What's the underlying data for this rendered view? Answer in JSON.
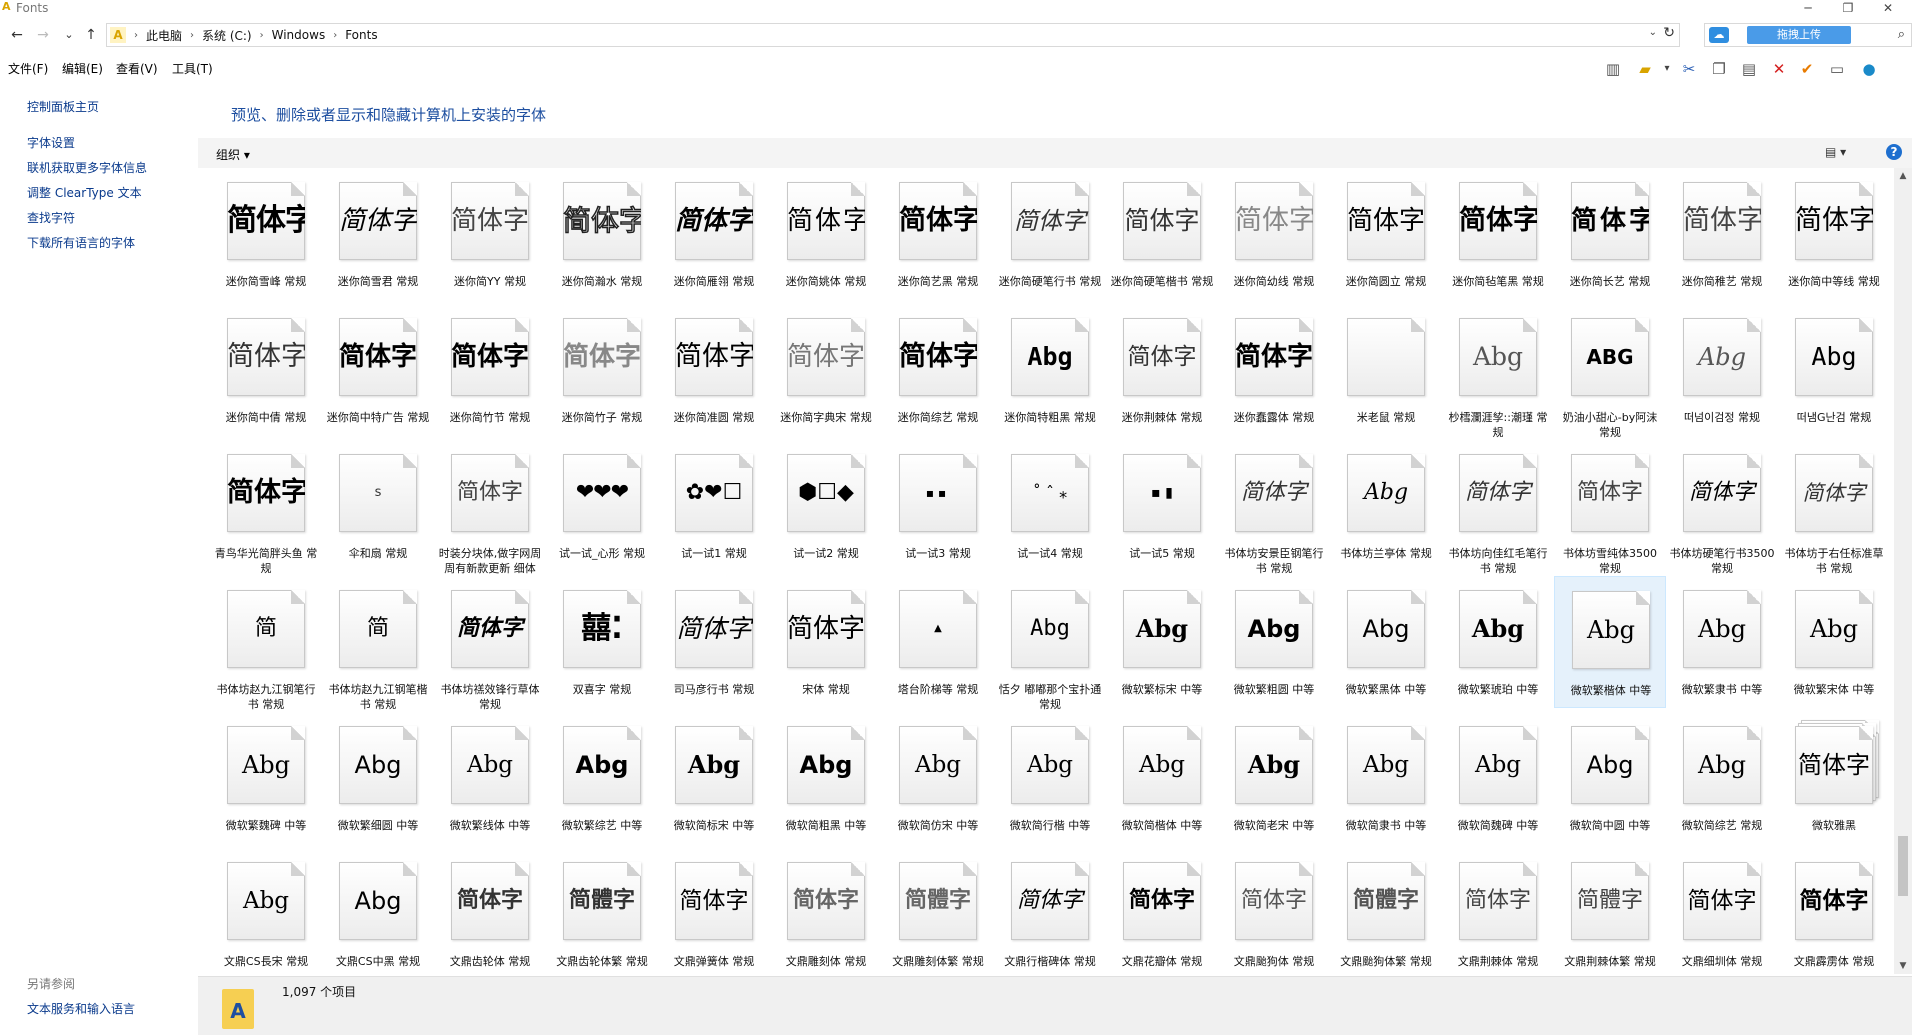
{
  "window": {
    "title": "Fonts",
    "app_icon": "fonts-folder-icon"
  },
  "window_controls": {
    "minimize": "─",
    "maximize": "❐",
    "close": "✕"
  },
  "nav": {
    "back": "←",
    "forward": "→",
    "recent": "⌄",
    "up": "↑"
  },
  "address": {
    "crumbs": [
      "此电脑",
      "系统 (C:)",
      "Windows",
      "Fonts"
    ],
    "dropdown": "⌄",
    "refresh": "↻"
  },
  "search": {
    "upload_label": "拖拽上传",
    "baidu_icon": "☁",
    "search_icon": "⌕"
  },
  "menu": [
    "文件(F)",
    "编辑(E)",
    "查看(V)",
    "工具(T)"
  ],
  "toolbar_icons": [
    "panel-icon",
    "folder-icon",
    "cut-icon",
    "copy-icon",
    "paste-icon",
    "delete-icon",
    "check-icon",
    "rename-icon",
    "network-icon"
  ],
  "sidebar": {
    "links": [
      "控制面板主页",
      "字体设置",
      "联机获取更多字体信息",
      "调整 ClearType 文本",
      "查找字符",
      "下载所有语言的字体"
    ],
    "see_also": "另请参阅",
    "see_also_links": [
      "文本服务和输入语言"
    ]
  },
  "page_title": "预览、删除或者显示和隐藏计算机上安装的字体",
  "cmdbar": {
    "organize": "组织 ▾",
    "view_icon": "▤ ▾",
    "help_icon": "?"
  },
  "fonts": [
    {
      "preview": "简体字",
      "name": "迷你简雪峰 常规",
      "style": "font-weight:bold;font-size:30px;letter-spacing:-1px;"
    },
    {
      "preview": "简体字",
      "name": "迷你简雪君 常规",
      "style": "font-size:26px;font-style:italic;"
    },
    {
      "preview": "简体字",
      "name": "迷你简YY 常规",
      "style": "font-size:26px;color:#444;"
    },
    {
      "preview": "简体字",
      "name": "迷你简瀚水 常规",
      "style": "font-size:28px;color:#fff;-webkit-text-stroke:1.5px #222;"
    },
    {
      "preview": "简体字",
      "name": "迷你简雁翎 常规",
      "style": "font-weight:bold;font-size:26px;font-style:italic;"
    },
    {
      "preview": "简体字",
      "name": "迷你简姚体 常规",
      "style": "font-size:26px;letter-spacing:2px;"
    },
    {
      "preview": "简体字",
      "name": "迷你简艺黑 常规",
      "style": "font-weight:bold;font-size:27px;"
    },
    {
      "preview": "简体字",
      "name": "迷你简硬笔行书 常规",
      "style": "font-size:24px;font-style:italic;color:#333;"
    },
    {
      "preview": "简体字",
      "name": "迷你简硬笔楷书 常规",
      "style": "font-size:25px;color:#333;"
    },
    {
      "preview": "简体字",
      "name": "迷你简幼线 常规",
      "style": "font-size:27px;color:#888;"
    },
    {
      "preview": "简体字",
      "name": "迷你简圆立 常规",
      "style": "font-size:26px;"
    },
    {
      "preview": "简体字",
      "name": "迷你简毡笔黑 常规",
      "style": "font-weight:bold;font-size:27px;"
    },
    {
      "preview": "简体字",
      "name": "迷你简长艺 常规",
      "style": "font-weight:bold;font-size:26px;letter-spacing:3px;"
    },
    {
      "preview": "简体字",
      "name": "迷你简稚艺 常规",
      "style": "font-size:27px;color:#444;"
    },
    {
      "preview": "简体字",
      "name": "迷你简中等线 常规",
      "style": "font-size:27px;"
    },
    {
      "preview": "简体字",
      "name": "迷你简中倩 常规",
      "style": "font-size:27px;color:#333;"
    },
    {
      "preview": "简体字",
      "name": "迷你简中特广告 常规",
      "style": "font-weight:bold;font-size:26px;"
    },
    {
      "preview": "简体字",
      "name": "迷你简竹节 常规",
      "style": "font-weight:bold;font-size:26px;"
    },
    {
      "preview": "简体字",
      "name": "迷你简竹子 常规",
      "style": "font-size:26px;color:#888;font-weight:bold;"
    },
    {
      "preview": "简体字",
      "name": "迷你简准圆 常规",
      "style": "font-size:27px;"
    },
    {
      "preview": "简体字",
      "name": "迷你简字典宋 常规",
      "style": "font-size:26px;color:#777;"
    },
    {
      "preview": "简体字",
      "name": "迷你简综艺 常规",
      "style": "font-weight:bold;font-size:27px;"
    },
    {
      "preview": "Abg",
      "name": "迷你简特粗黑 常规",
      "style": "font-family:'DejaVu Sans Mono',monospace;font-weight:bold;font-size:25px;"
    },
    {
      "preview": "简体字",
      "name": "迷你荆棘体 常规",
      "style": "font-size:23px;color:#333;"
    },
    {
      "preview": "简体字",
      "name": "迷你蠢露体 常规",
      "style": "font-weight:bold;font-size:26px;"
    },
    {
      "preview": "",
      "name": "米老鼠 常规",
      "style": ""
    },
    {
      "preview": "Abg",
      "name": "杪樰瀾涯孧::潮瑾 常规",
      "style": "font-family:'DejaVu Serif',serif;font-size:25px;color:#555;"
    },
    {
      "preview": "ABG",
      "name": "奶油小甜心-by阿沫 常规",
      "style": "font-weight:bold;font-size:20px;"
    },
    {
      "preview": "Abg",
      "name": "떠넘이검정 常规",
      "style": "font-family:'DejaVu Serif',serif;font-style:italic;font-size:24px;color:#555;"
    },
    {
      "preview": "Abg",
      "name": "떠냄G난검 常规",
      "style": "font-family:'DejaVu Sans Mono',monospace;font-size:25px;"
    },
    {
      "preview": "简体字",
      "name": "青鸟华光简胖头鱼 常规",
      "style": "font-weight:bold;font-size:27px;"
    },
    {
      "preview": "s",
      "name": "伞和扇 常规",
      "style": "font-size:13px;color:#333;"
    },
    {
      "preview": "简体字",
      "name": "时装分块体,做字网周周有新款更新 细体",
      "style": "font-size:22px;color:#444;"
    },
    {
      "preview": "❤❤❤",
      "name": "试一试_心形 常规",
      "style": "font-size:22px;letter-spacing:-1px;"
    },
    {
      "preview": "✿❤☐",
      "name": "试一试1 常规",
      "style": "font-size:22px;"
    },
    {
      "preview": "⬢☐◆",
      "name": "试一试2 常规",
      "style": "font-size:22px;"
    },
    {
      "preview": "▪▪",
      "name": "试一试3 常规",
      "style": "font-size:12px;letter-spacing:4px;"
    },
    {
      "preview": "˚  ˆ  ⁎",
      "name": "试一试4 常规",
      "style": "font-size:16px;"
    },
    {
      "preview": "▪   ▮",
      "name": "试一试5 常规",
      "style": "font-size:14px;"
    },
    {
      "preview": "简体字",
      "name": "书体坊安景臣钢笔行书 常规",
      "style": "font-size:22px;font-style:italic;color:#333;"
    },
    {
      "preview": "Abg",
      "name": "书体坊兰亭体 常规",
      "style": "font-family:'DejaVu Serif',serif;font-style:italic;font-size:22px;"
    },
    {
      "preview": "简体字",
      "name": "书体坊向佳红毛笔行书 常规",
      "style": "font-size:22px;font-style:italic;color:#333;"
    },
    {
      "preview": "简体字",
      "name": "书体坊雪纯体3500 常规",
      "style": "font-size:22px;color:#444;"
    },
    {
      "preview": "简体字",
      "name": "书体坊硬笔行书3500 常规",
      "style": "font-size:22px;font-style:italic;"
    },
    {
      "preview": "简体字",
      "name": "书体坊于右任标准草书 常规",
      "style": "font-size:21px;font-style:italic;color:#333;"
    },
    {
      "preview": "简",
      "name": "书体坊赵九江钢笔行书 常规",
      "style": "font-size:22px;"
    },
    {
      "preview": "简",
      "name": "书体坊赵九江钢笔楷书 常规",
      "style": "font-size:22px;"
    },
    {
      "preview": "简体字",
      "name": "书体坊禚效锋行草体 常规",
      "style": "font-size:22px;font-weight:bold;font-style:italic;"
    },
    {
      "preview": "囍⁚",
      "name": "双喜字 常规",
      "style": "font-size:30px;font-weight:bold;"
    },
    {
      "preview": "简体字",
      "name": "司马彦行书 常规",
      "style": "font-size:25px;font-style:italic;"
    },
    {
      "preview": "简体字",
      "name": "宋体 常规",
      "style": "font-family:'DejaVu Serif',serif;font-size:26px;"
    },
    {
      "preview": "▲",
      "name": "塔台阶梯等 常规",
      "style": "font-size:10px;"
    },
    {
      "preview": "Abg",
      "name": "恬夕 嘟嘟那个宝扑通 常规",
      "style": "font-family:'DejaVu Sans Mono',monospace;font-size:22px;"
    },
    {
      "preview": "Abg",
      "name": "微软繁标宋 中等",
      "style": "font-family:'DejaVu Serif',serif;font-weight:bold;font-size:24px;"
    },
    {
      "preview": "Abg",
      "name": "微软繁粗圆 中等",
      "style": "font-weight:bold;font-size:24px;"
    },
    {
      "preview": "Abg",
      "name": "微软繁黑体 中等",
      "style": "font-size:24px;"
    },
    {
      "preview": "Abg",
      "name": "微软繁琥珀 中等",
      "style": "font-family:'DejaVu Serif',serif;font-weight:bold;font-size:24px;"
    },
    {
      "preview": "Abg",
      "name": "微软繁楷体 中等",
      "style": "font-family:'DejaVu Serif',serif;font-size:24px;"
    },
    {
      "preview": "Abg",
      "name": "微软繁隶书 中等",
      "style": "font-family:'DejaVu Serif',serif;font-size:24px;"
    },
    {
      "preview": "Abg",
      "name": "微软繁宋体 中等",
      "style": "font-family:'DejaVu Serif',serif;font-size:24px;"
    },
    {
      "preview": "Abg",
      "name": "微软繁魏碑 中等",
      "style": "font-family:'DejaVu Serif',serif;font-size:24px;"
    },
    {
      "preview": "Abg",
      "name": "微软繁细圆 中等",
      "style": "font-size:24px;"
    },
    {
      "preview": "Abg",
      "name": "微软繁线体 中等",
      "style": "font-family:'DejaVu Serif',serif;font-size:23px;"
    },
    {
      "preview": "Abg",
      "name": "微软繁综艺 中等",
      "style": "font-weight:bold;font-size:24px;"
    },
    {
      "preview": "Abg",
      "name": "微软简标宋 中等",
      "style": "font-family:'DejaVu Serif',serif;font-weight:bold;font-size:24px;"
    },
    {
      "preview": "Abg",
      "name": "微软简粗黑 中等",
      "style": "font-weight:bold;font-size:24px;"
    },
    {
      "preview": "Abg",
      "name": "微软简仿宋 中等",
      "style": "font-family:'DejaVu Serif',serif;font-size:23px;"
    },
    {
      "preview": "Abg",
      "name": "微软简行楷 中等",
      "style": "font-family:'DejaVu Serif',serif;font-size:23px;"
    },
    {
      "preview": "Abg",
      "name": "微软简楷体 中等",
      "style": "font-family:'DejaVu Serif',serif;font-size:23px;"
    },
    {
      "preview": "Abg",
      "name": "微软简老宋 中等",
      "style": "font-family:'DejaVu Serif',serif;font-weight:bold;font-size:24px;"
    },
    {
      "preview": "Abg",
      "name": "微软简隶书 中等",
      "style": "font-family:'DejaVu Serif',serif;font-size:23px;"
    },
    {
      "preview": "Abg",
      "name": "微软简魏碑 中等",
      "style": "font-family:'DejaVu Serif',serif;font-size:23px;"
    },
    {
      "preview": "Abg",
      "name": "微软简中圆 中等",
      "style": "font-size:24px;"
    },
    {
      "preview": "Abg",
      "name": "微软简综艺 常规",
      "style": "font-family:'DejaVu Serif',serif;font-size:24px;"
    },
    {
      "preview": "简体字",
      "name": "微软雅黑",
      "style": "font-size:24px;",
      "stack": true
    },
    {
      "preview": "Abg",
      "name": "文鼎CS長宋 常规",
      "style": "font-family:'DejaVu Serif',serif;font-size:23px;"
    },
    {
      "preview": "Abg",
      "name": "文鼎CS中黑 常规",
      "style": "font-size:24px;"
    },
    {
      "preview": "简体字",
      "name": "文鼎齿轮体 常规",
      "style": "font-size:22px;font-weight:bold;color:#333;"
    },
    {
      "preview": "简體字",
      "name": "文鼎齿轮体繁 常规",
      "style": "font-size:22px;font-weight:bold;color:#333;"
    },
    {
      "preview": "简体字",
      "name": "文鼎弹簧体 常规",
      "style": "font-size:23px;"
    },
    {
      "preview": "简体字",
      "name": "文鼎雕刻体 常规",
      "style": "font-size:22px;color:#666;font-weight:bold;"
    },
    {
      "preview": "简體字",
      "name": "文鼎雕刻体繁 常规",
      "style": "font-size:22px;color:#666;font-weight:bold;"
    },
    {
      "preview": "简体字",
      "name": "文鼎行楷碑体 常规",
      "style": "font-size:22px;font-style:italic;"
    },
    {
      "preview": "简体字",
      "name": "文鼎花瓣体 常规",
      "style": "font-size:22px;font-weight:bold;"
    },
    {
      "preview": "简体字",
      "name": "文鼎颱狗体 常规",
      "style": "font-size:22px;color:#555;"
    },
    {
      "preview": "简體字",
      "name": "文鼎颱狗体繁 常规",
      "style": "font-size:22px;color:#555;font-weight:bold;"
    },
    {
      "preview": "简体字",
      "name": "文鼎荆棘体 常规",
      "style": "font-size:22px;color:#444;"
    },
    {
      "preview": "简體字",
      "name": "文鼎荆棘体繁 常规",
      "style": "font-size:22px;color:#444;"
    },
    {
      "preview": "简体字",
      "name": "文鼎细圳体 常规",
      "style": "font-size:23px;"
    },
    {
      "preview": "简体字",
      "name": "文鼎霹雳体 常规",
      "style": "font-size:23px;font-weight:bold;"
    }
  ],
  "selected_font_index": 57,
  "status": {
    "count": "1,097 个项目"
  }
}
